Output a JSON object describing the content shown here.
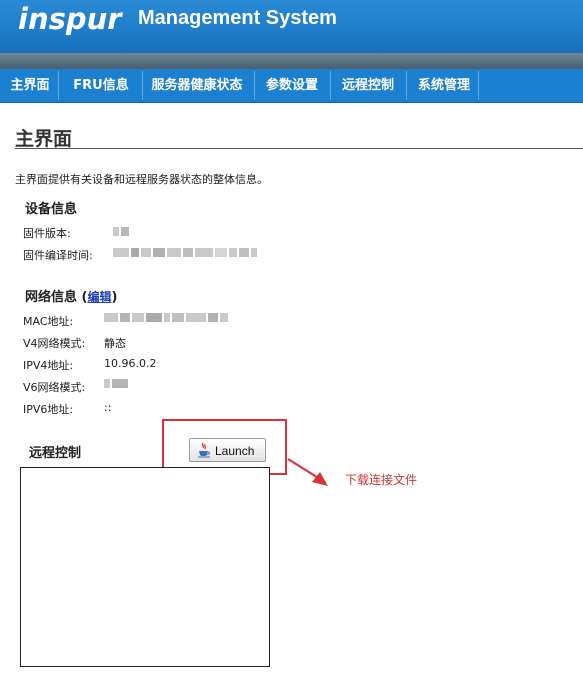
{
  "header": {
    "logo_text": "inspur",
    "app_title": "Management System"
  },
  "nav": {
    "items": [
      {
        "label": "主界面"
      },
      {
        "label": "FRU信息"
      },
      {
        "label": "服务器健康状态"
      },
      {
        "label": "参数设置"
      },
      {
        "label": "远程控制"
      },
      {
        "label": "系统管理"
      }
    ]
  },
  "page": {
    "title": "主界面",
    "description": "主界面提供有关设备和远程服务器状态的整体信息。"
  },
  "device_info": {
    "heading": "设备信息",
    "firmware_version_label": "固件版本:",
    "firmware_build_time_label": "固件编译时间:"
  },
  "network_info": {
    "heading": "网络信息",
    "edit_link": "编辑",
    "mac_label": "MAC地址:",
    "v4_mode_label": "V4网络模式:",
    "v4_mode_value": "静态",
    "ipv4_label": "IPV4地址:",
    "ipv4_value": "10.96.0.2",
    "v6_mode_label": "V6网络模式:",
    "ipv6_label": "IPV6地址:",
    "ipv6_value": "::"
  },
  "remote_control": {
    "heading": "远程控制",
    "launch_label": "Launch",
    "annotation": "下载连接文件"
  },
  "colors": {
    "header_blue": "#1e7cc8",
    "nav_blue": "#1c80d0",
    "annotation_red": "#d8323b",
    "link_blue": "#1a3fb8"
  }
}
